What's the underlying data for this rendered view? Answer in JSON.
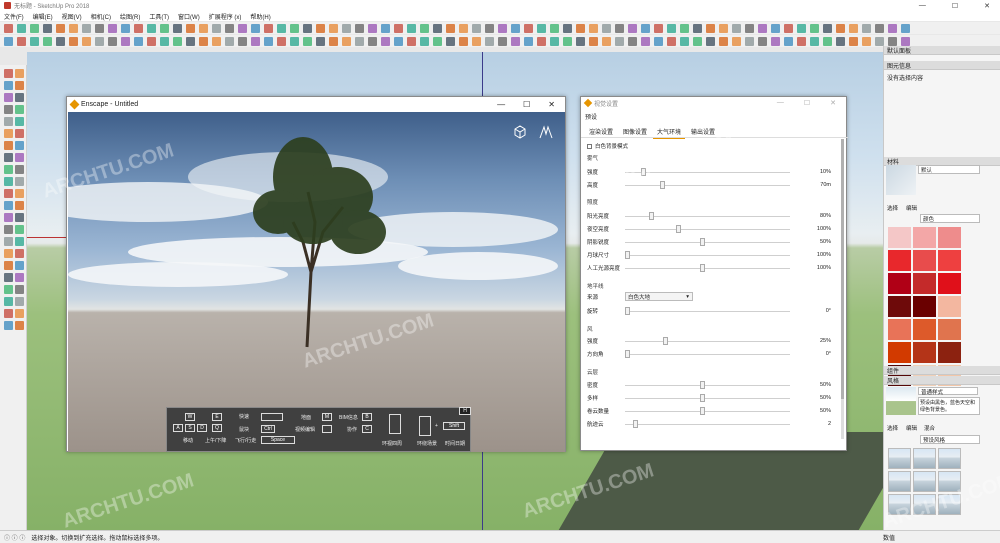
{
  "app": {
    "title": "无标题 - SketchUp Pro 2018"
  },
  "menu": [
    "文件(F)",
    "编辑(E)",
    "视图(V)",
    "相机(C)",
    "绘图(R)",
    "工具(T)",
    "窗口(W)",
    "扩展程序 (x)",
    "帮助(H)"
  ],
  "window_controls": [
    "—",
    "☐",
    "✕"
  ],
  "enscape": {
    "title": "Enscape - Untitled",
    "hud": {
      "keys": [
        "W",
        "E",
        "A",
        "S",
        "D",
        "Q"
      ],
      "labels": [
        "移动",
        "上午/下降",
        "快速",
        "鼠块",
        "飞行/行走",
        "地面",
        "视频编辑",
        "BIM信息",
        "协作",
        "环视四周",
        "环绕场景",
        "时间日期"
      ],
      "key_ctrl": "Ctrl",
      "key_space": "Space",
      "key_shift": "Shift",
      "key_m": "M",
      "key_b": "B",
      "key_c": "C",
      "key_h": "H"
    }
  },
  "visual_settings": {
    "title": "视觉设置",
    "preset_label": "预设",
    "tabs": [
      "渲染设置",
      "图像设置",
      "大气环境",
      "输出设置"
    ],
    "active_tab": "大气环境",
    "white_bg_label": "白色背景模式",
    "sections": {
      "fog": "雾气",
      "brightness": "照度",
      "horizon": "地平线",
      "wind": "风",
      "clouds": "云层"
    },
    "rows": [
      {
        "label": "强度",
        "value": "10%",
        "pos": 0.1
      },
      {
        "label": "高度",
        "value": "70m",
        "pos": 0.22
      },
      {
        "label": "阳光亮度",
        "value": "80%",
        "pos": 0.15
      },
      {
        "label": "夜空亮度",
        "value": "100%",
        "pos": 0.32
      },
      {
        "label": "阴影锐度",
        "value": "50%",
        "pos": 0.47
      },
      {
        "label": "月球尺寸",
        "value": "100%",
        "pos": 0.0
      },
      {
        "label": "人工光源亮度",
        "value": "100%",
        "pos": 0.47
      },
      {
        "label": "旋转",
        "value": "0°",
        "pos": 0.0
      },
      {
        "label": "强度",
        "value": "25%",
        "pos": 0.24
      },
      {
        "label": "方向角",
        "value": "0°",
        "pos": 0.0
      },
      {
        "label": "密度",
        "value": "50%",
        "pos": 0.47
      },
      {
        "label": "多样",
        "value": "50%",
        "pos": 0.47
      },
      {
        "label": "卷云数量",
        "value": "50%",
        "pos": 0.47
      },
      {
        "label": "航迹云",
        "value": "2",
        "pos": 0.05
      }
    ],
    "source_label": "来源",
    "source_value": "白色大地"
  },
  "tray": {
    "title": "默认面板",
    "entity_info": "图元信息",
    "no_selection": "没有选择内容",
    "materials": "材料",
    "default_mat": "默认",
    "select_tab": "选择",
    "edit_tab": "编辑",
    "color_dropdown": "颜色",
    "components": "组件",
    "styles": "风格",
    "style_name": "普通样式",
    "style_desc": "预设由黑色，蓝色天空和绿色背景色。",
    "style_tabs": [
      "选择",
      "编辑",
      "混合"
    ],
    "style_dropdown": "预设风格",
    "swatches": [
      "#f4c7c7",
      "#f3a7a7",
      "#ee8c8c",
      "#e8282c",
      "#e84c4c",
      "#ee4040",
      "#b00016",
      "#c42a2a",
      "#e0101a",
      "#6e0a0a",
      "#6a0000",
      "#f3b7a0",
      "#e87358",
      "#dd5a2a",
      "#e0744e",
      "#d23a00",
      "#b43418",
      "#8c2210",
      "#540808",
      "#f0d0b8",
      "#f2c6a8"
    ]
  },
  "status": {
    "text": "选择对象。切换到扩充选择。拖动鼠标选择多项。",
    "measure": "数值"
  },
  "watermark": "ARCHTU.COM"
}
